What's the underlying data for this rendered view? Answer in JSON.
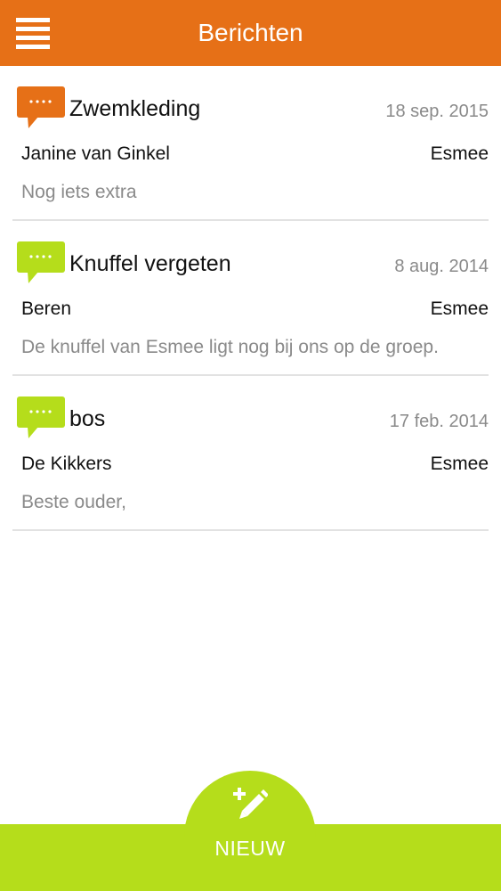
{
  "header": {
    "title": "Berichten",
    "menu_icon": "hamburger-menu-icon",
    "color": "#e67017"
  },
  "messages": [
    {
      "subject": "Zwemkleding",
      "date": "18 sep. 2015",
      "sender": "Janine van Ginkel",
      "recipient": "Esmee",
      "preview": "Nog iets extra",
      "icon": "chat-bubble-icon",
      "icon_color": "#e67017",
      "unread": true
    },
    {
      "subject": "Knuffel vergeten",
      "date": "8 aug. 2014",
      "sender": "Beren",
      "recipient": "Esmee",
      "preview": "De knuffel van Esmee ligt nog bij ons op de groep.",
      "icon": "chat-bubble-icon",
      "icon_color": "#b5dd1b",
      "unread": false
    },
    {
      "subject": "bos",
      "date": "17 feb. 2014",
      "sender": "De Kikkers",
      "recipient": "Esmee",
      "preview": "Beste ouder,",
      "icon": "chat-bubble-icon",
      "icon_color": "#b5dd1b",
      "unread": false
    }
  ],
  "footer": {
    "new_label": "NIEUW",
    "new_icon": "compose-pencil-icon",
    "color": "#b5dd1b"
  }
}
